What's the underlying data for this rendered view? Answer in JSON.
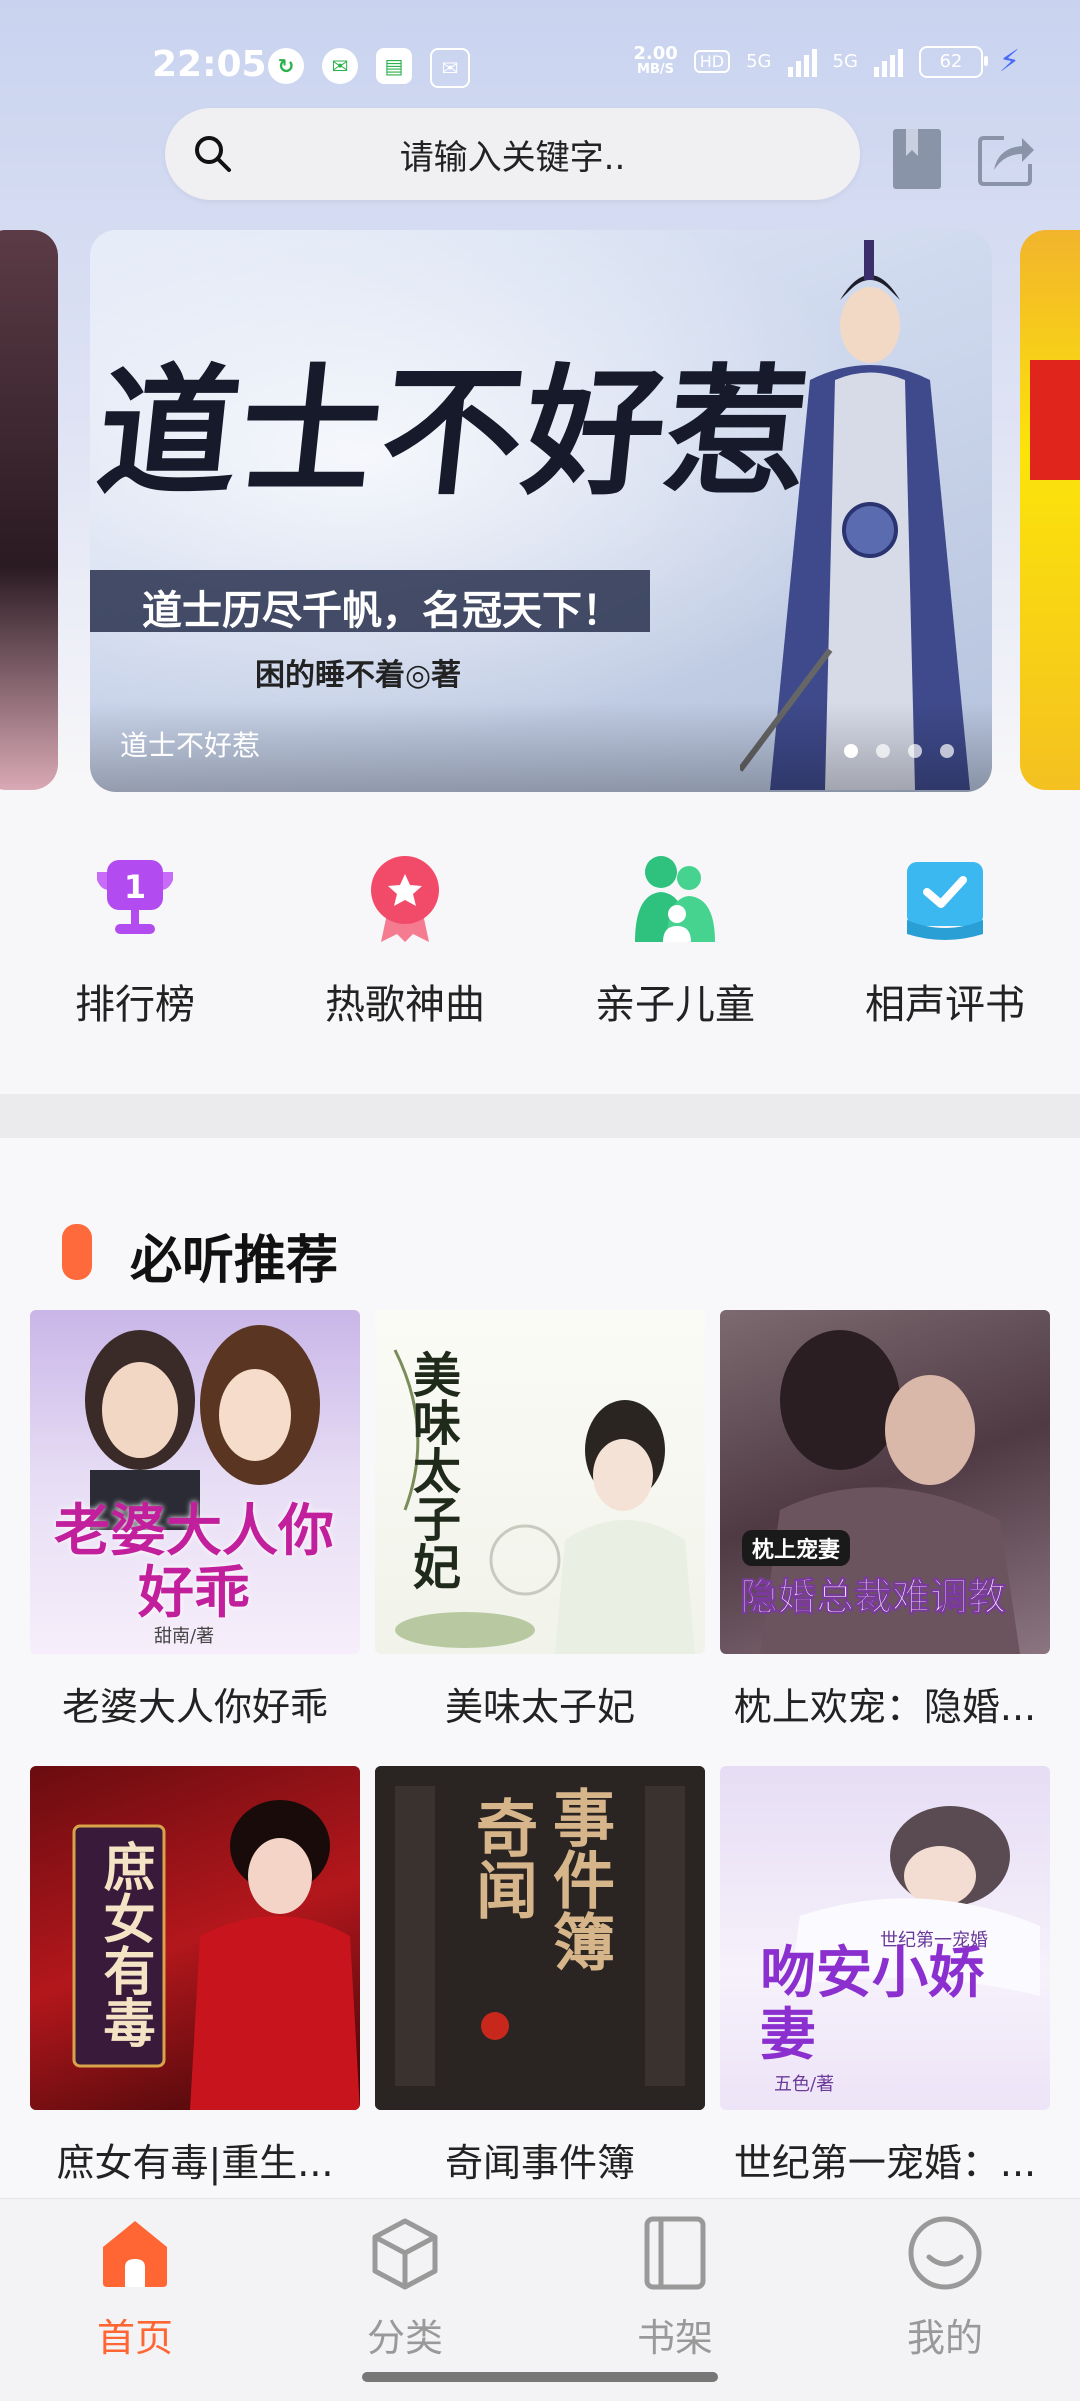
{
  "status_bar": {
    "time": "22:05",
    "speed_value": "2.00",
    "speed_unit": "MB/S",
    "hd": "HD",
    "net1": "5G",
    "net2": "5G",
    "battery": "62"
  },
  "search": {
    "placeholder": "请输入关键字.."
  },
  "banner": {
    "title": "道士不好惹",
    "subtitle": "道士历尽千帆，名冠天下！",
    "author": "困的睡不着◎著",
    "caption": "道士不好惹"
  },
  "categories": [
    {
      "label": "排行榜",
      "icon": "trophy-icon",
      "color": "#b34cf0"
    },
    {
      "label": "热歌神曲",
      "icon": "medal-icon",
      "color": "#f24b6a"
    },
    {
      "label": "亲子儿童",
      "icon": "family-icon",
      "color": "#2ec27e"
    },
    {
      "label": "相声评书",
      "icon": "book-check-icon",
      "color": "#3cb8f0"
    }
  ],
  "section": {
    "title": "必听推荐",
    "books": [
      {
        "title": "老婆大人你好乖",
        "cover_text": "老婆大人你好乖",
        "cover_author": "甜南/著"
      },
      {
        "title": "美味太子妃",
        "cover_text": "美味太子妃"
      },
      {
        "title": "枕上欢宠：隐婚...",
        "cover_tag": "枕上宠妻",
        "cover_text": "隐婚总裁难调教"
      },
      {
        "title": "庶女有毒|重生...",
        "cover_text": "庶女有毒"
      },
      {
        "title": "奇闻事件簿",
        "cover_text_a": "奇闻",
        "cover_text_b": "事件簿"
      },
      {
        "title": "世纪第一宠婚：...",
        "cover_text": "吻安小娇妻",
        "cover_sub": "世纪第一宠婚",
        "cover_author": "五色/著"
      }
    ]
  },
  "nav": [
    {
      "label": "首页",
      "icon": "home-icon",
      "active": true
    },
    {
      "label": "分类",
      "icon": "cube-icon",
      "active": false
    },
    {
      "label": "书架",
      "icon": "bookshelf-icon",
      "active": false
    },
    {
      "label": "我的",
      "icon": "profile-icon",
      "active": false
    }
  ],
  "colors": {
    "accent": "#ff6633",
    "section_mark": "#ff6a3d"
  }
}
